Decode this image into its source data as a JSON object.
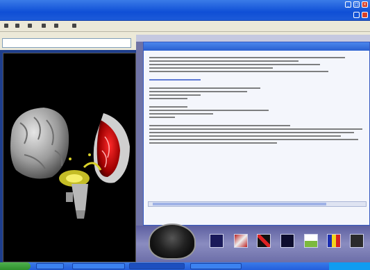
{
  "window": {
    "title_top": "",
    "title_main": ""
  },
  "panel": {
    "header": ""
  },
  "dialog": {
    "title": "",
    "pager": ""
  },
  "icons": [
    "minimize-icon",
    "maximize-icon",
    "close-icon",
    "pointer-tool-icon",
    "color-scale-icon",
    "slice-tool-icon",
    "dark-view-icon",
    "color-map-icon",
    "flag-palette-icon",
    "figure-icon"
  ],
  "colors": {
    "title_blue": "#245edb",
    "panel_purple": "#6f73a6",
    "viewport_bg": "#000000",
    "start_green": "#2f8f2c"
  }
}
